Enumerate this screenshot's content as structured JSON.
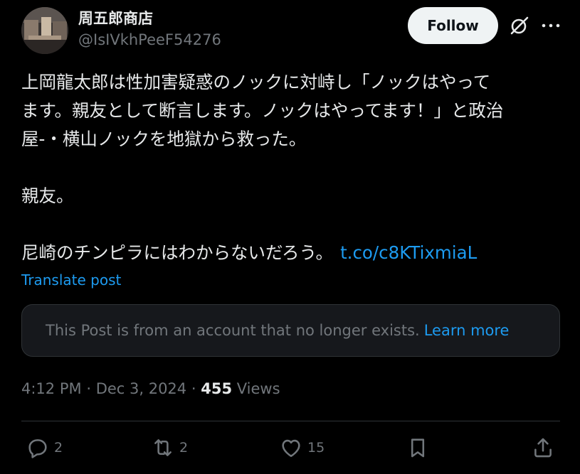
{
  "author": {
    "name": "周五郎商店",
    "handle": "@IsIVkhPeeF54276",
    "avatar_icon": "profile-photo"
  },
  "header": {
    "follow_label": "Follow",
    "grok_icon": "slashed-circle-icon",
    "more_icon": "more-dots-icon"
  },
  "tweet": {
    "line1": "上岡龍太郎は性加害疑惑のノックに対峙し「ノックはやって",
    "line2": "ます。親友として断言します。ノックはやってます！」と政治",
    "line3": "屋-・横山ノックを地獄から救った。",
    "line4": "親友。",
    "line5": "尼崎のチンピラにはわからないだろう。",
    "link": "t.co/c8KTixmiaL",
    "translate_label": "Translate post"
  },
  "notice": {
    "text": "This Post is from an account that no longer exists.",
    "link": "Learn more"
  },
  "meta": {
    "time": "4:12 PM",
    "separator": "·",
    "date": "Dec 3, 2024",
    "views_count": "455",
    "views_label": "Views"
  },
  "actions": {
    "reply_count": "2",
    "repost_count": "2",
    "like_count": "15"
  },
  "colors": {
    "background": "#000000",
    "text": "#e7e9ea",
    "secondary": "#71767b",
    "accent": "#1d9bf0"
  }
}
